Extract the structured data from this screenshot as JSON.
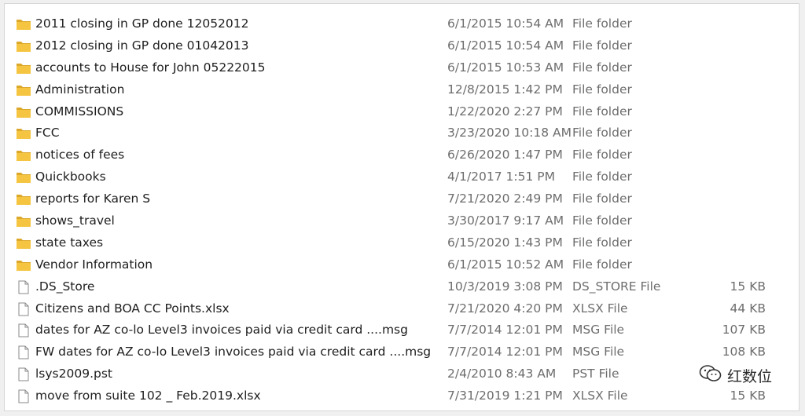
{
  "files": [
    {
      "name": "2011 closing in GP done 12052012",
      "date": "6/1/2015 10:54 AM",
      "type": "File folder",
      "size": "",
      "icon": "folder-icon"
    },
    {
      "name": "2012 closing in GP done 01042013",
      "date": "6/1/2015 10:54 AM",
      "type": "File folder",
      "size": "",
      "icon": "folder-icon"
    },
    {
      "name": "accounts to House for John 05222015",
      "date": "6/1/2015 10:53 AM",
      "type": "File folder",
      "size": "",
      "icon": "folder-icon"
    },
    {
      "name": "Administration",
      "date": "12/8/2015 1:42 PM",
      "type": "File folder",
      "size": "",
      "icon": "folder-icon"
    },
    {
      "name": "COMMISSIONS",
      "date": "1/22/2020 2:27 PM",
      "type": "File folder",
      "size": "",
      "icon": "folder-icon"
    },
    {
      "name": "FCC",
      "date": "3/23/2020 10:18 AM",
      "type": "File folder",
      "size": "",
      "icon": "folder-icon"
    },
    {
      "name": "notices of fees",
      "date": "6/26/2020 1:47 PM",
      "type": "File folder",
      "size": "",
      "icon": "folder-icon"
    },
    {
      "name": "Quickbooks",
      "date": "4/1/2017 1:51 PM",
      "type": "File folder",
      "size": "",
      "icon": "folder-icon"
    },
    {
      "name": "reports for Karen S",
      "date": "7/21/2020 2:49 PM",
      "type": "File folder",
      "size": "",
      "icon": "folder-icon"
    },
    {
      "name": "shows_travel",
      "date": "3/30/2017 9:17 AM",
      "type": "File folder",
      "size": "",
      "icon": "folder-icon"
    },
    {
      "name": "state taxes",
      "date": "6/15/2020 1:43 PM",
      "type": "File folder",
      "size": "",
      "icon": "folder-icon"
    },
    {
      "name": "Vendor Information",
      "date": "6/1/2015 10:52 AM",
      "type": "File folder",
      "size": "",
      "icon": "folder-icon"
    },
    {
      "name": ".DS_Store",
      "date": "10/3/2019 3:08 PM",
      "type": "DS_STORE File",
      "size": "15 KB",
      "icon": "file-icon"
    },
    {
      "name": "Citizens and BOA CC Points.xlsx",
      "date": "7/21/2020 4:20 PM",
      "type": "XLSX File",
      "size": "44 KB",
      "icon": "file-icon"
    },
    {
      "name": "dates for AZ co-lo Level3 invoices paid via credit card ....msg",
      "date": "7/7/2014 12:01 PM",
      "type": "MSG File",
      "size": "107 KB",
      "icon": "file-icon"
    },
    {
      "name": "FW dates for AZ co-lo Level3 invoices paid via credit card ....msg",
      "date": "7/7/2014 12:01 PM",
      "type": "MSG File",
      "size": "108 KB",
      "icon": "file-icon"
    },
    {
      "name": "lsys2009.pst",
      "date": "2/4/2010 8:43 AM",
      "type": "PST File",
      "size": "",
      "icon": "file-icon"
    },
    {
      "name": "move from suite 102 _ Feb.2019.xlsx",
      "date": "7/31/2019 1:21 PM",
      "type": "XLSX File",
      "size": "15 KB",
      "icon": "file-icon"
    }
  ],
  "watermark": {
    "text": "红数位",
    "icon": "wechat-icon"
  },
  "colors": {
    "folder": "#f5c542",
    "folder_dark": "#dca82a",
    "secondary_text": "#6d6d6d"
  }
}
